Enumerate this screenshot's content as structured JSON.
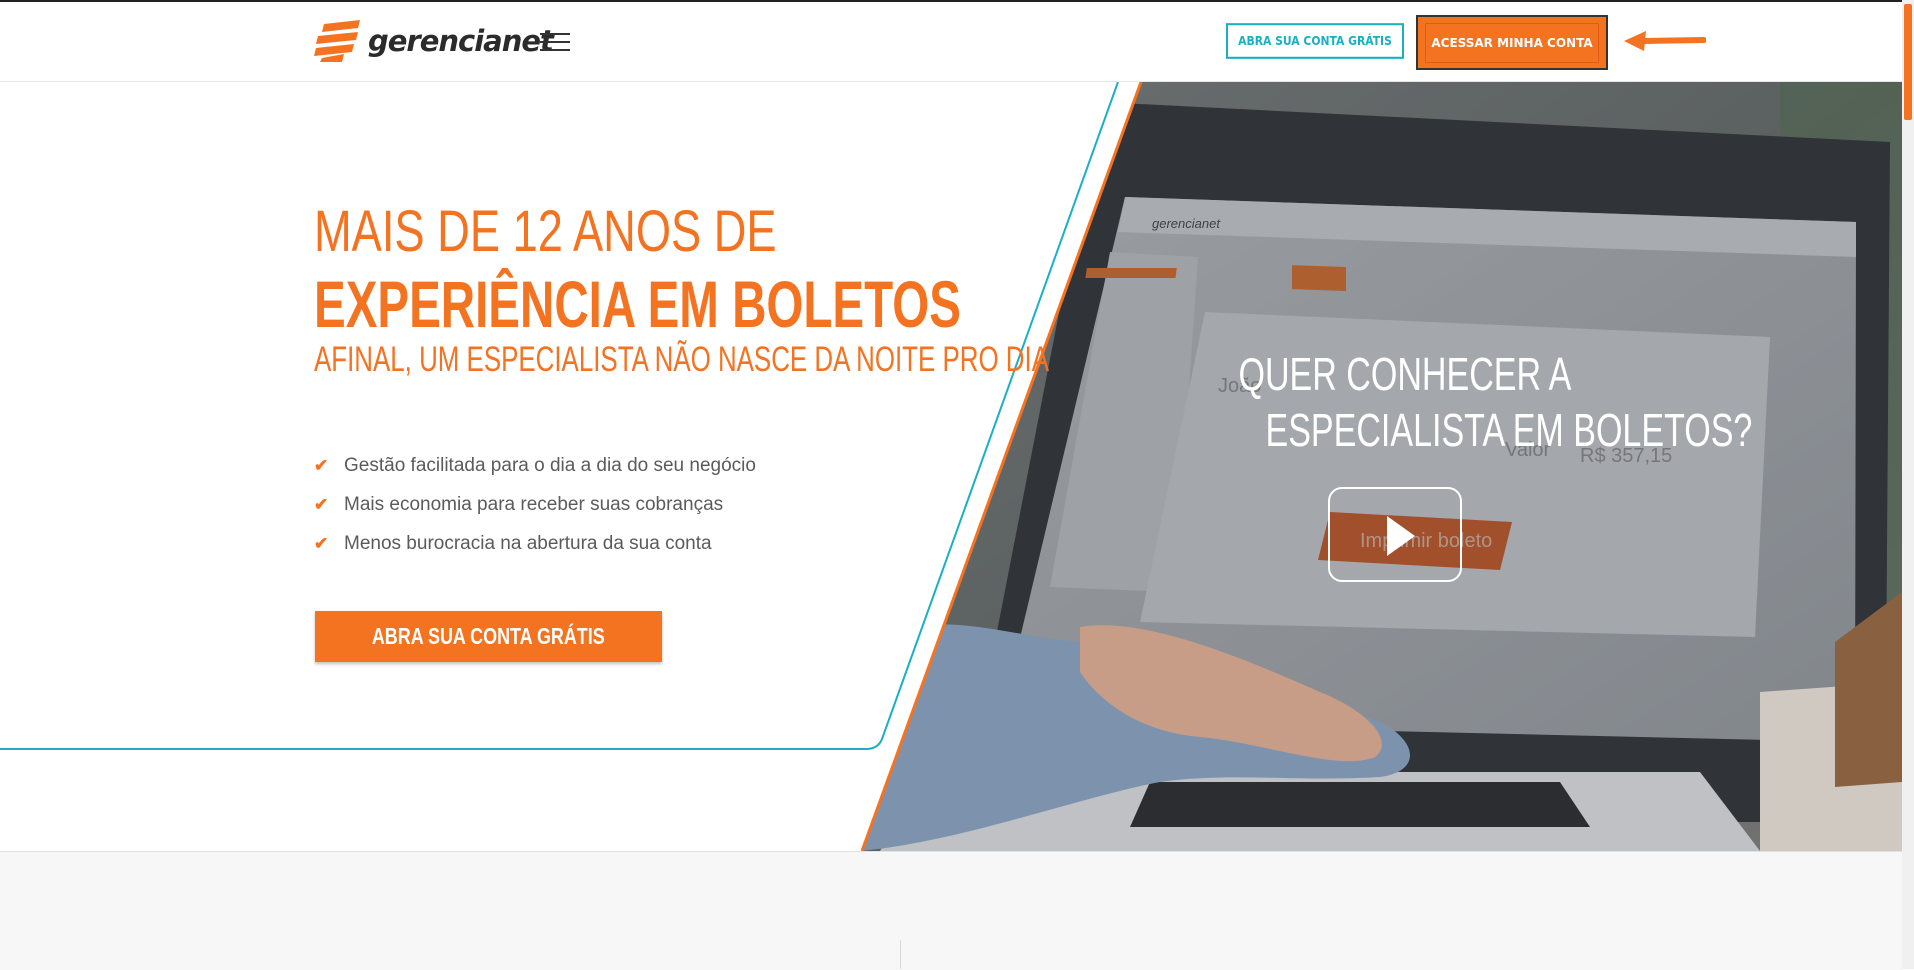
{
  "header": {
    "logo_text": "gerencianet",
    "open_account_button": "ABRA SUA CONTA GRÁTIS",
    "access_account_button": "ACESSAR MINHA CONTA"
  },
  "hero": {
    "title_line1": "MAIS DE 12 ANOS DE",
    "title_line2": "EXPERIÊNCIA EM BOLETOS",
    "subtitle": "AFINAL, UM ESPECIALISTA NÃO NASCE DA NOITE PRO DIA",
    "features": [
      "Gestão facilitada para o dia a dia do seu negócio",
      "Mais economia para receber suas cobranças",
      "Menos burocracia na abertura da sua conta"
    ],
    "cta_label": "ABRA SUA CONTA GRÁTIS"
  },
  "video": {
    "title_line1": "QUER CONHECER A",
    "title_line2": "ESPECIALISTA EM BOLETOS?",
    "screen_field_name": "João",
    "screen_field_label": "Valor",
    "screen_field_value": "R$ 357,15",
    "screen_button": "Imprimir boleto"
  },
  "colors": {
    "brand_orange": "#f47321",
    "accent_teal": "#1ab0c4",
    "text_gray": "#5b5b5b"
  }
}
